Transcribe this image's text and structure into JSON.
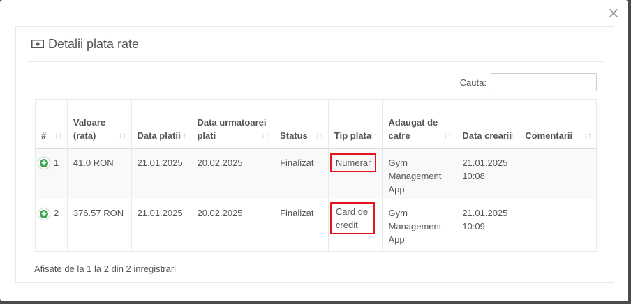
{
  "modal": {
    "close_glyph": "×"
  },
  "panel": {
    "title": "Detalii plata rate",
    "icon": "money-icon"
  },
  "search": {
    "label": "Cauta:",
    "value": ""
  },
  "table": {
    "headers": [
      "#",
      "Valoare (rata)",
      "Data platii",
      "Data urmatoarei plati",
      "Status",
      "Tip plata",
      "Adaugat de catre",
      "Data crearii",
      "Comentarii"
    ],
    "sort_glyph": "↓↑",
    "rows": [
      {
        "num": "1",
        "value": "41.0 RON",
        "paid": "21.01.2025",
        "next": "20.02.2025",
        "status": "Finalizat",
        "type": "Numerar",
        "added_by": "Gym Management App",
        "created": "21.01.2025 10:08",
        "comments": ""
      },
      {
        "num": "2",
        "value": "376.57 RON",
        "paid": "21.01.2025",
        "next": "20.02.2025",
        "status": "Finalizat",
        "type": "Card de credit",
        "added_by": "Gym Management App",
        "created": "21.01.2025 10:09",
        "comments": ""
      }
    ]
  },
  "footer": {
    "info": "Afisate de la 1 la 2 din 2 inregistrari"
  },
  "colors": {
    "highlight": "#e8141b",
    "expand": "#3ea651"
  }
}
